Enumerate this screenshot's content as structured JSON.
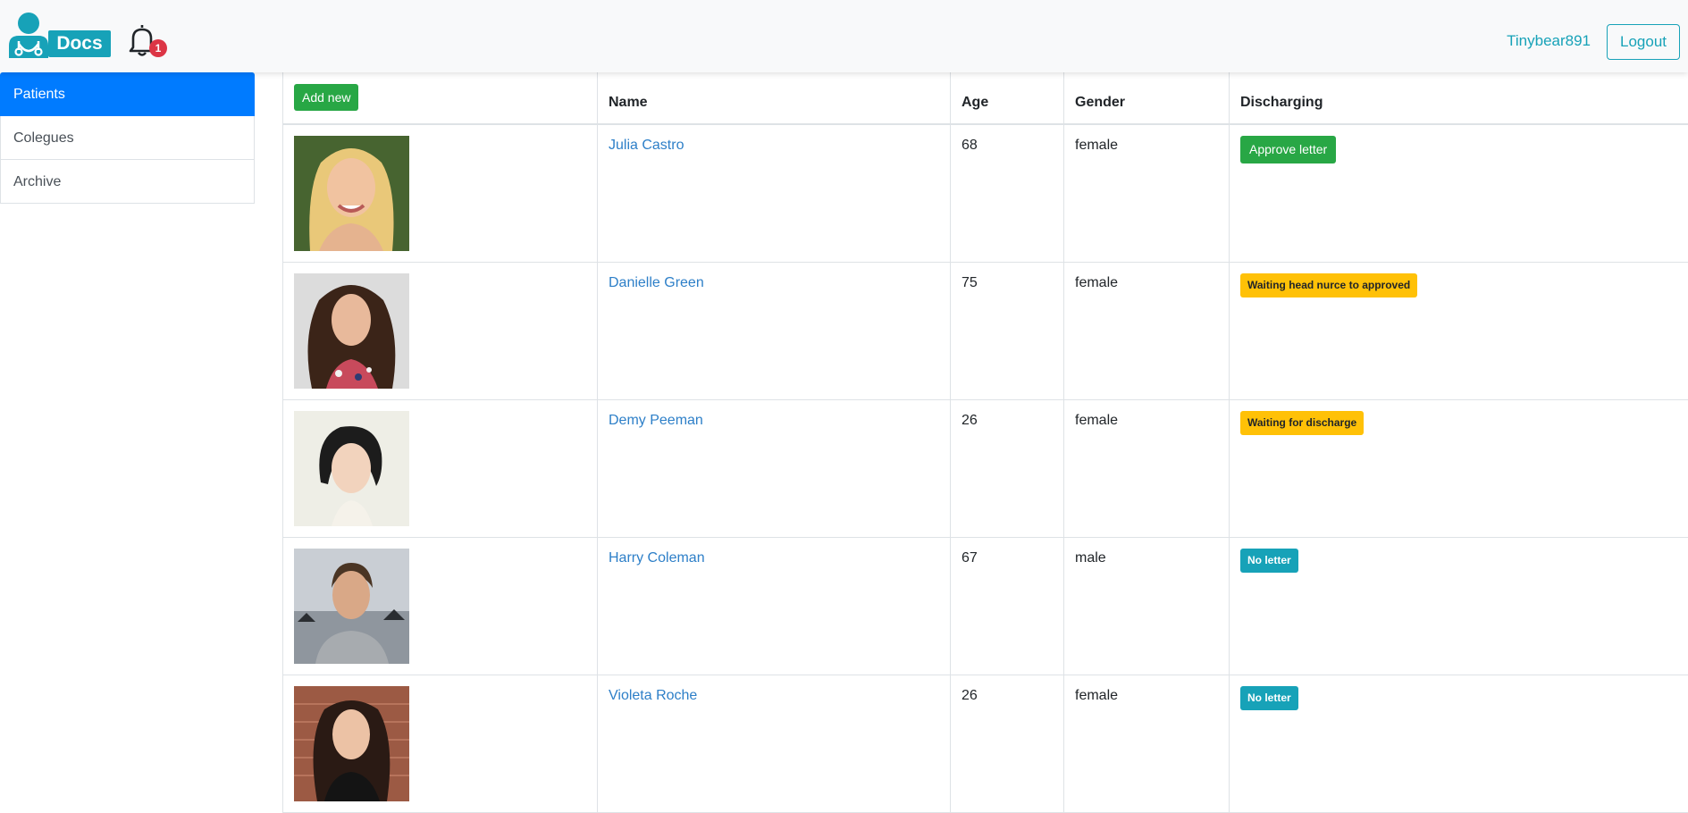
{
  "navbar": {
    "logo_text": "Docs",
    "notifications_count": "1",
    "username": "Tinybear891",
    "logout_label": "Logout"
  },
  "sidebar": {
    "items": [
      {
        "label": "Patients",
        "active": true
      },
      {
        "label": "Colegues",
        "active": false
      },
      {
        "label": "Archive",
        "active": false
      }
    ]
  },
  "table": {
    "add_new_label": "Add new",
    "headers": {
      "name": "Name",
      "age": "Age",
      "gender": "Gender",
      "discharging": "Discharging"
    },
    "rows": [
      {
        "name": "Julia Castro",
        "age": "68",
        "gender": "female",
        "status": "Approve letter",
        "status_type": "approve",
        "photo": "woman-blonde-photo"
      },
      {
        "name": "Danielle Green",
        "age": "75",
        "gender": "female",
        "status": "Waiting head nurce to approved",
        "status_type": "warning",
        "photo": "woman-curly-hair-photo"
      },
      {
        "name": "Demy Peeman",
        "age": "26",
        "gender": "female",
        "status": "Waiting for discharge",
        "status_type": "warning",
        "photo": "woman-short-hair-photo"
      },
      {
        "name": "Harry Coleman",
        "age": "67",
        "gender": "male",
        "status": "No letter",
        "status_type": "info",
        "photo": "man-photo"
      },
      {
        "name": "Violeta Roche",
        "age": "26",
        "gender": "female",
        "status": "No letter",
        "status_type": "info",
        "photo": "woman-dark-hair-photo"
      }
    ]
  },
  "colors": {
    "primary": "#007bff",
    "success": "#28a745",
    "warning": "#ffc107",
    "info": "#17a2b8",
    "danger": "#dc3545",
    "link": "#2d7fc8"
  }
}
